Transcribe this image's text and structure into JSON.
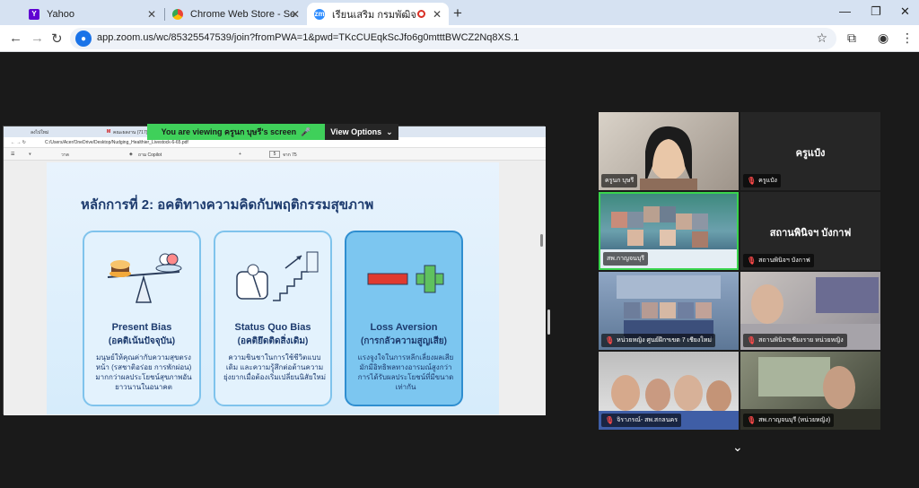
{
  "browser": {
    "tabs": [
      {
        "title": "Yahoo",
        "icon": "yahoo-icon"
      },
      {
        "title": "Chrome Web Store - Search Re",
        "icon": "chrome-web-store-icon"
      },
      {
        "title": "เรียนเสริม กรมพัฒิจ",
        "icon": "zoom-icon"
      }
    ],
    "url": "app.zoom.us/wc/85325547539/join?fromPWA=1&pwd=TKcCUEqkScJfo6g0mtttBWCZ2Nq8XS.1"
  },
  "share": {
    "viewing_banner": "You are viewing ครูนก บุษรี's screen",
    "view_options": "View Options",
    "inner_url": "C:/Users/Acer/OneDrive/Desktop/Nudging_Healthier_Livestock-6-65.pdf",
    "inner_tab1": "ลงไปใหม่",
    "inner_tab2": "คณะผลงาน (717)",
    "pdf_page": "5",
    "pdf_total": "จาก 75",
    "pdf_tool_draw": "วาด",
    "pdf_copilot": "ถาม Copilot"
  },
  "slide": {
    "title": "หลักการที่ 2: อคติทางความคิดกับพฤติกรรมสุขภาพ",
    "cards": [
      {
        "title": "Present Bias",
        "subtitle": "(อคติเน้นปัจจุบัน)",
        "desc": "มนุษย์ให้คุณค่ากับความสุขตรงหน้า (รสชาติอร่อย การพักผ่อน) มากกว่าผลประโยชน์สุขภาพอันยาวนานในอนาคต"
      },
      {
        "title": "Status Quo Bias",
        "subtitle": "(อคติยึดติดสิ่งเดิม)",
        "desc": "ความชินชาในการใช้ชีวิตแบบเดิม และความรู้สึกต่อต้านความยุ่งยากเมื่อต้องเริ่มเปลี่ยนนิสัยใหม่"
      },
      {
        "title": "Loss Aversion",
        "subtitle": "(การกลัวความสูญเสีย)",
        "desc": "แรงจูงใจในการหลีกเลี่ยงผลเสียมักมีอิทธิพลทางอารมณ์สูงกว่าการได้รับผลประโยชน์ที่มีขนาดเท่ากัน"
      }
    ]
  },
  "participants": [
    {
      "name": "ครูนก บุษรี",
      "muted": false
    },
    {
      "name": "ครูแป๋ง",
      "muted": true,
      "big": "ครูแป๋ง"
    },
    {
      "name": "สพ.กาญจนบุรี",
      "muted": false
    },
    {
      "name": "สถานพินิจฯ บังกาฟ",
      "muted": true,
      "big": "สถานพินิจฯ บังกาฟ"
    },
    {
      "name": "หน่วยหญิง ศูนย์ฝึกฯเขต 7 เชียงใหม่",
      "muted": true
    },
    {
      "name": "สถานพินิจฯเชียงราย หน่วยหญิง",
      "muted": true
    },
    {
      "name": "จิราภรณ์- สพ.สกลนคร",
      "muted": true
    },
    {
      "name": "สพ.กาญจนบุรี (หน่วยหญิง)",
      "muted": true
    }
  ]
}
